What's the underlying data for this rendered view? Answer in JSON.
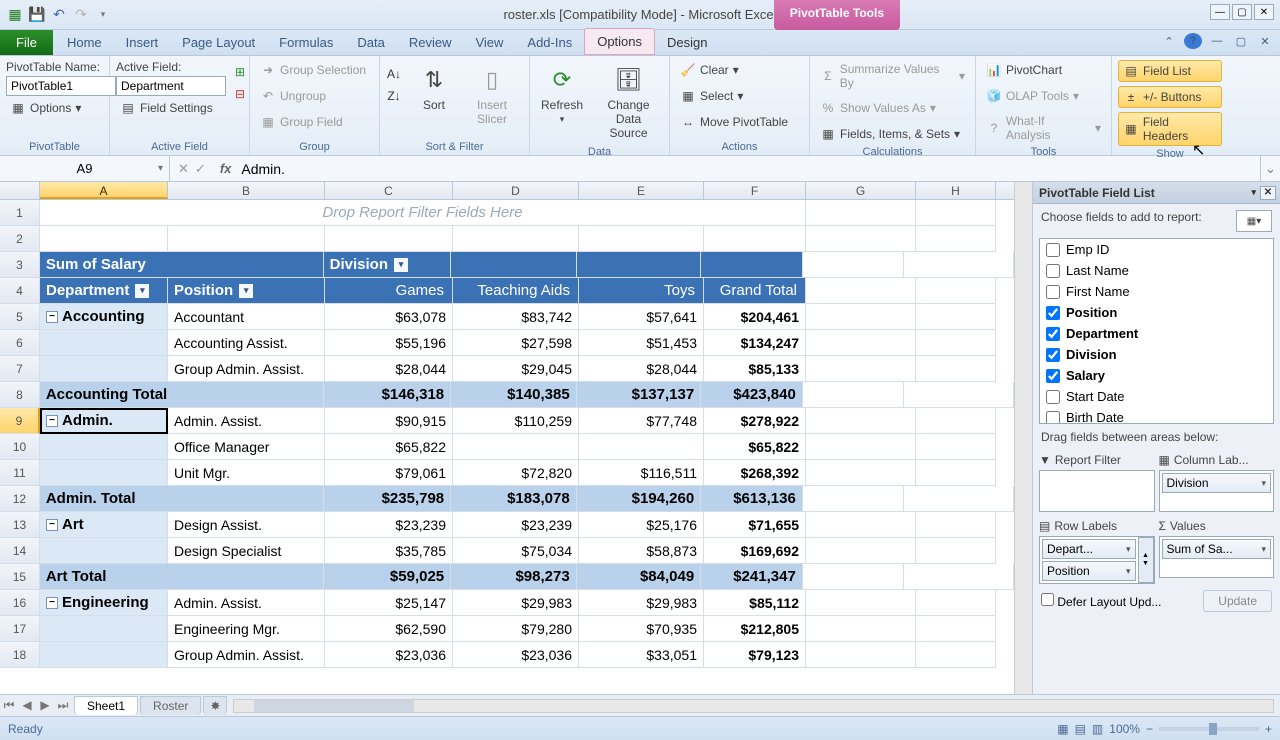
{
  "title": "roster.xls  [Compatibility Mode]  -  Microsoft Excel",
  "contextual_tab": "PivotTable Tools",
  "tabs": [
    "Home",
    "Insert",
    "Page Layout",
    "Formulas",
    "Data",
    "Review",
    "View",
    "Add-Ins",
    "Options",
    "Design"
  ],
  "file_tab": "File",
  "ribbon": {
    "pivottable": {
      "name_label": "PivotTable Name:",
      "name_value": "PivotTable1",
      "options": "Options",
      "group_label": "PivotTable"
    },
    "activefield": {
      "label": "Active Field:",
      "value": "Department",
      "settings": "Field Settings",
      "group_label": "Active Field"
    },
    "group": {
      "selection": "Group Selection",
      "ungroup": "Ungroup",
      "field": "Group Field",
      "group_label": "Group"
    },
    "sortfilter": {
      "sort": "Sort",
      "slicer": "Insert\nSlicer",
      "group_label": "Sort & Filter"
    },
    "data": {
      "refresh": "Refresh",
      "change": "Change Data\nSource",
      "group_label": "Data"
    },
    "actions": {
      "clear": "Clear",
      "select": "Select",
      "move": "Move PivotTable",
      "group_label": "Actions"
    },
    "calc": {
      "summarize": "Summarize Values By",
      "showas": "Show Values As",
      "fields": "Fields, Items, & Sets",
      "group_label": "Calculations"
    },
    "tools": {
      "chart": "PivotChart",
      "olap": "OLAP Tools",
      "whatif": "What-If Analysis",
      "group_label": "Tools"
    },
    "show": {
      "fieldlist": "Field List",
      "buttons": "+/- Buttons",
      "headers": "Field Headers",
      "group_label": "Show"
    }
  },
  "namebox": "A9",
  "formula": "Admin.",
  "columns": [
    "A",
    "B",
    "C",
    "D",
    "E",
    "F",
    "G",
    "H"
  ],
  "pivot": {
    "filter_prompt": "Drop Report Filter Fields Here",
    "measure": "Sum of Salary",
    "col_field": "Division",
    "row_fields": [
      "Department",
      "Position"
    ],
    "col_labels": [
      "Games",
      "Teaching Aids",
      "Toys",
      "Grand Total"
    ],
    "rows": [
      {
        "r": 5,
        "type": "dept",
        "dept": "Accounting",
        "pos": "Accountant",
        "vals": [
          "$63,078",
          "$83,742",
          "$57,641",
          "$204,461"
        ]
      },
      {
        "r": 6,
        "type": "pos",
        "pos": "Accounting Assist.",
        "vals": [
          "$55,196",
          "$27,598",
          "$51,453",
          "$134,247"
        ]
      },
      {
        "r": 7,
        "type": "pos",
        "pos": "Group Admin. Assist.",
        "vals": [
          "$28,044",
          "$29,045",
          "$28,044",
          "$85,133"
        ]
      },
      {
        "r": 8,
        "type": "total",
        "label": "Accounting Total",
        "vals": [
          "$146,318",
          "$140,385",
          "$137,137",
          "$423,840"
        ]
      },
      {
        "r": 9,
        "type": "dept",
        "dept": "Admin.",
        "pos": "Admin. Assist.",
        "vals": [
          "$90,915",
          "$110,259",
          "$77,748",
          "$278,922"
        ],
        "sel": true
      },
      {
        "r": 10,
        "type": "pos",
        "pos": "Office Manager",
        "vals": [
          "$65,822",
          "",
          "",
          "$65,822"
        ]
      },
      {
        "r": 11,
        "type": "pos",
        "pos": "Unit Mgr.",
        "vals": [
          "$79,061",
          "$72,820",
          "$116,511",
          "$268,392"
        ]
      },
      {
        "r": 12,
        "type": "total",
        "label": "Admin. Total",
        "vals": [
          "$235,798",
          "$183,078",
          "$194,260",
          "$613,136"
        ]
      },
      {
        "r": 13,
        "type": "dept",
        "dept": "Art",
        "pos": "Design Assist.",
        "vals": [
          "$23,239",
          "$23,239",
          "$25,176",
          "$71,655"
        ]
      },
      {
        "r": 14,
        "type": "pos",
        "pos": "Design Specialist",
        "vals": [
          "$35,785",
          "$75,034",
          "$58,873",
          "$169,692"
        ]
      },
      {
        "r": 15,
        "type": "total",
        "label": "Art Total",
        "vals": [
          "$59,025",
          "$98,273",
          "$84,049",
          "$241,347"
        ]
      },
      {
        "r": 16,
        "type": "dept",
        "dept": "Engineering",
        "pos": "Admin. Assist.",
        "vals": [
          "$25,147",
          "$29,983",
          "$29,983",
          "$85,112"
        ]
      },
      {
        "r": 17,
        "type": "pos",
        "pos": "Engineering Mgr.",
        "vals": [
          "$62,590",
          "$79,280",
          "$70,935",
          "$212,805"
        ]
      },
      {
        "r": 18,
        "type": "pos",
        "pos": "Group Admin. Assist.",
        "vals": [
          "$23,036",
          "$23,036",
          "$33,051",
          "$79,123"
        ]
      }
    ]
  },
  "sheets": [
    "Sheet1",
    "Roster"
  ],
  "status": {
    "ready": "Ready",
    "zoom": "100%"
  },
  "fieldlist": {
    "title": "PivotTable Field List",
    "choose": "Choose fields to add to report:",
    "fields": [
      {
        "name": "Emp ID",
        "checked": false
      },
      {
        "name": "Last Name",
        "checked": false
      },
      {
        "name": "First Name",
        "checked": false
      },
      {
        "name": "Position",
        "checked": true
      },
      {
        "name": "Department",
        "checked": true
      },
      {
        "name": "Division",
        "checked": true
      },
      {
        "name": "Salary",
        "checked": true
      },
      {
        "name": "Start Date",
        "checked": false
      },
      {
        "name": "Birth Date",
        "checked": false
      }
    ],
    "drag_label": "Drag fields between areas below:",
    "areas": {
      "filter": "Report Filter",
      "columns": "Column Lab...",
      "rows": "Row Labels",
      "values": "Values",
      "col_items": [
        "Division"
      ],
      "row_items": [
        "Depart...",
        "Position"
      ],
      "val_items": [
        "Sum of Sa..."
      ]
    },
    "defer": "Defer Layout Upd...",
    "update": "Update"
  },
  "chart_data": {
    "type": "table",
    "measure": "Sum of Salary",
    "column_field": "Division",
    "row_fields": [
      "Department",
      "Position"
    ],
    "columns": [
      "Games",
      "Teaching Aids",
      "Toys",
      "Grand Total"
    ],
    "data": [
      {
        "Department": "Accounting",
        "Position": "Accountant",
        "Games": 63078,
        "Teaching Aids": 83742,
        "Toys": 57641,
        "Grand Total": 204461
      },
      {
        "Department": "Accounting",
        "Position": "Accounting Assist.",
        "Games": 55196,
        "Teaching Aids": 27598,
        "Toys": 51453,
        "Grand Total": 134247
      },
      {
        "Department": "Accounting",
        "Position": "Group Admin. Assist.",
        "Games": 28044,
        "Teaching Aids": 29045,
        "Toys": 28044,
        "Grand Total": 85133
      },
      {
        "Department": "Accounting",
        "Position": "_TOTAL",
        "Games": 146318,
        "Teaching Aids": 140385,
        "Toys": 137137,
        "Grand Total": 423840
      },
      {
        "Department": "Admin.",
        "Position": "Admin. Assist.",
        "Games": 90915,
        "Teaching Aids": 110259,
        "Toys": 77748,
        "Grand Total": 278922
      },
      {
        "Department": "Admin.",
        "Position": "Office Manager",
        "Games": 65822,
        "Teaching Aids": null,
        "Toys": null,
        "Grand Total": 65822
      },
      {
        "Department": "Admin.",
        "Position": "Unit Mgr.",
        "Games": 79061,
        "Teaching Aids": 72820,
        "Toys": 116511,
        "Grand Total": 268392
      },
      {
        "Department": "Admin.",
        "Position": "_TOTAL",
        "Games": 235798,
        "Teaching Aids": 183078,
        "Toys": 194260,
        "Grand Total": 613136
      },
      {
        "Department": "Art",
        "Position": "Design Assist.",
        "Games": 23239,
        "Teaching Aids": 23239,
        "Toys": 25176,
        "Grand Total": 71655
      },
      {
        "Department": "Art",
        "Position": "Design Specialist",
        "Games": 35785,
        "Teaching Aids": 75034,
        "Toys": 58873,
        "Grand Total": 169692
      },
      {
        "Department": "Art",
        "Position": "_TOTAL",
        "Games": 59025,
        "Teaching Aids": 98273,
        "Toys": 84049,
        "Grand Total": 241347
      },
      {
        "Department": "Engineering",
        "Position": "Admin. Assist.",
        "Games": 25147,
        "Teaching Aids": 29983,
        "Toys": 29983,
        "Grand Total": 85112
      },
      {
        "Department": "Engineering",
        "Position": "Engineering Mgr.",
        "Games": 62590,
        "Teaching Aids": 79280,
        "Toys": 70935,
        "Grand Total": 212805
      },
      {
        "Department": "Engineering",
        "Position": "Group Admin. Assist.",
        "Games": 23036,
        "Teaching Aids": 23036,
        "Toys": 33051,
        "Grand Total": 79123
      }
    ]
  }
}
